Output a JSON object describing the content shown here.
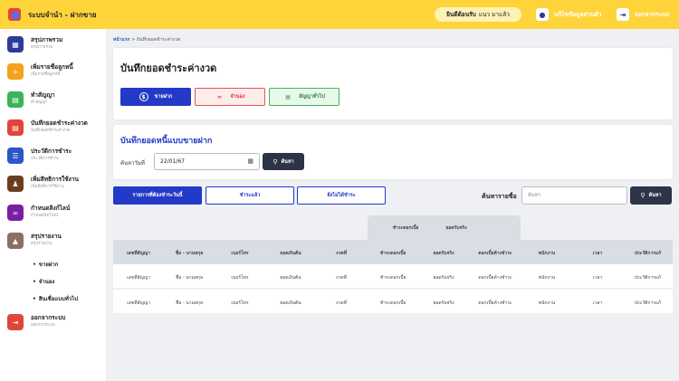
{
  "app": {
    "title": "ระบบจำนำ - ฝากขาย"
  },
  "topbar": {
    "welcome_bold": "ยินดีต้อนรับ",
    "welcome_name": "แนว มาแล้ว",
    "profile_label": "แก้ไขข้อมูลส่วนตัว",
    "logout_label": "ออกจากระบบ"
  },
  "sidebar": {
    "items": [
      {
        "label": "สรุปภาพรวม",
        "sub": "สรุปภาพรวม",
        "icon": "dashboard-icon",
        "color": "#2c3a99"
      },
      {
        "label": "เพิ่มรายชื่อลูกหนี้",
        "sub": "เพิ่มรายชื่อลูกหนี้",
        "icon": "add-debtor-icon",
        "color": "#f4a21c"
      },
      {
        "label": "ทำสัญญา",
        "sub": "ทำสัญญา",
        "icon": "contract-icon",
        "color": "#3cb35a"
      },
      {
        "label": "บันทึกยอดชำระค่างวด",
        "sub": "บันทึกยอดชำระค่างวด",
        "icon": "payment-icon",
        "color": "#e0463a"
      },
      {
        "label": "ประวัติการชำระ",
        "sub": "ประวัติการชำระ",
        "icon": "history-icon",
        "color": "#2c56c9"
      },
      {
        "label": "เพิ่มสิทธิการใช้งาน",
        "sub": "เพิ่มสิทธิการใช้งาน",
        "icon": "users-icon",
        "color": "#6b3d1f"
      },
      {
        "label": "กำหนดลิงก์ไลน์",
        "sub": "กำหนดลิงก์ไลน์",
        "icon": "link-icon",
        "color": "#7b1fa2"
      },
      {
        "label": "สรุปรายงาน",
        "sub": "สรุปรายงาน",
        "icon": "report-icon",
        "color": "#8d6e63"
      }
    ],
    "subitems": [
      "ขายฝาก",
      "จำนอง",
      "สินเชื่อแบบทั่วไป"
    ],
    "logout": {
      "label": "ออกจากระบบ",
      "sub": "ออกจากระบบ",
      "icon": "logout-icon",
      "color": "#e0463a"
    }
  },
  "breadcrumb": {
    "home": "หน้าแรก",
    "sep": ">",
    "current": "บันทึกยอดชำระค่างวด"
  },
  "page": {
    "title": "บันทึกยอดชำระค่างวด"
  },
  "modes": {
    "sale": "ขายฝาก",
    "mortgage": "จำนอง",
    "general": "สัญญาทั่วไป"
  },
  "section": {
    "title": "บันทึกยอดหนี้แบบขายฝาก",
    "date_label": "ค้นหาวันที่",
    "date_value": "22/01/67",
    "search_label": "ค้นหา"
  },
  "tabs": {
    "due": "รายการที่ต้องชำระวันนี้",
    "paid": "ชำระแล้ว",
    "unpaid": "ยังไม่ได้ชำระ"
  },
  "name_search": {
    "label": "ค้นหารายชื่อ",
    "placeholder": "ค้นหา",
    "button": "ค้นหา"
  },
  "table": {
    "group_headers": [
      "ชำระดอกเบี้ย",
      "ยอดรับจริง"
    ],
    "columns": [
      "เลขที่สัญญา",
      "ชื่อ - นามสกุล",
      "เบอร์โทร",
      "ยอดเงินต้น",
      "งวดที่",
      "ชำระดอกเบี้ย",
      "ยอดรับจริง",
      "ดอกเบี้ยค้างชำระ",
      "พนักงาน",
      "เวลา",
      "ประวัติการแก้"
    ],
    "rows": [
      [
        "เลขที่สัญญา",
        "ชื่อ - นามสกุล",
        "เบอร์โทร",
        "ยอดเงินต้น",
        "งวดที่",
        "ชำระดอกเบี้ย",
        "ยอดรับจริง",
        "ดอกเบี้ยค้างชำระ",
        "พนักงาน",
        "เวลา",
        "ประวัติการแก้"
      ],
      [
        "เลขที่สัญญา",
        "ชื่อ - นามสกุล",
        "เบอร์โทร",
        "ยอดเงินต้น",
        "งวดที่",
        "ชำระดอกเบี้ย",
        "ยอดรับจริง",
        "ดอกเบี้ยค้างชำระ",
        "พนักงาน",
        "เวลา",
        "ประวัติการแก้"
      ]
    ]
  }
}
